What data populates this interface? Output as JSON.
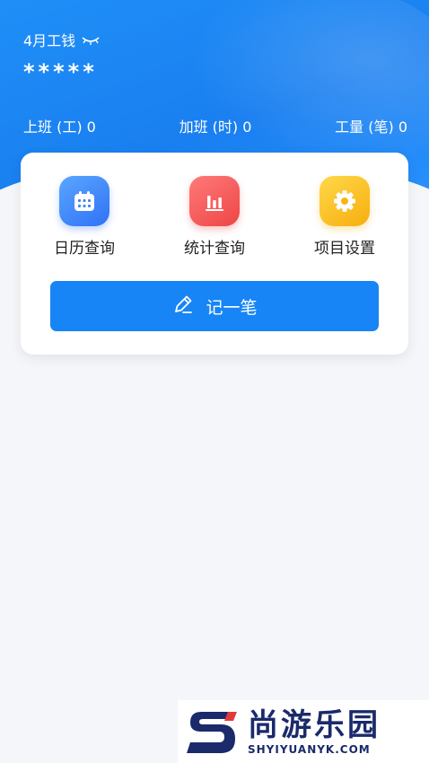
{
  "summary": {
    "month_label": "4月工钱",
    "amount_masked": "*****"
  },
  "stats": [
    {
      "label": "上班 (工) 0"
    },
    {
      "label": "加班 (时) 0"
    },
    {
      "label": "工量 (笔) 0"
    }
  ],
  "shortcuts": [
    {
      "label": "日历查询",
      "icon": "calendar-icon",
      "color": "#3a84f7"
    },
    {
      "label": "统计查询",
      "icon": "bar-chart-icon",
      "color": "#f05050"
    },
    {
      "label": "项目设置",
      "icon": "gear-icon",
      "color": "#f9b514"
    }
  ],
  "record_button": {
    "label": "记一笔",
    "icon": "pen-icon"
  },
  "watermark": {
    "cn": "尚游乐园",
    "en": "SHYIYUANYK.COM"
  },
  "colors": {
    "primary": "#1785f5",
    "background": "#f4f6f9"
  }
}
